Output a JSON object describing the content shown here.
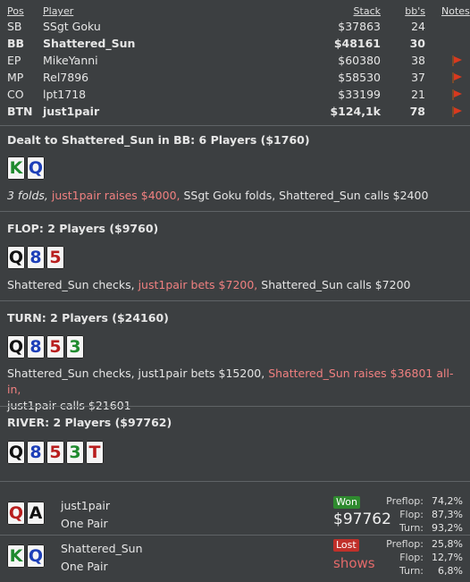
{
  "headers": {
    "pos": "Pos",
    "player": "Player",
    "stack": "Stack",
    "bbs": "bb's",
    "notes": "Notes"
  },
  "players": [
    {
      "pos": "SB",
      "name": "SSgt Goku",
      "stack": "$37863",
      "bbs": "24",
      "note_icon": ""
    },
    {
      "pos": "BB",
      "name": "Shattered_Sun",
      "stack": "$48161",
      "bbs": "30",
      "note_icon": ""
    },
    {
      "pos": "EP",
      "name": "MikeYanni",
      "stack": "$60380",
      "bbs": "38",
      "note_icon": "red-flag-icon"
    },
    {
      "pos": "MP",
      "name": "Rel7896",
      "stack": "$58530",
      "bbs": "37",
      "note_icon": "red-flag-icon"
    },
    {
      "pos": "CO",
      "name": "lpt1718",
      "stack": "$33199",
      "bbs": "21",
      "note_icon": "red-flag-icon"
    },
    {
      "pos": "BTN",
      "name": "just1pair",
      "stack": "$124,1k",
      "bbs": "78",
      "note_icon": "red-flag-icon"
    }
  ],
  "preflop": {
    "title": "Dealt to Shattered_Sun in BB: 6 Players ($1760)",
    "cards": [
      {
        "rank": "K",
        "suit": "green"
      },
      {
        "rank": "Q",
        "suit": "blue"
      }
    ],
    "folds": "3 folds,",
    "raise": "just1pair raises $4000,",
    "rest": "SSgt Goku folds, Shattered_Sun calls $2400"
  },
  "flop": {
    "title": "FLOP: 2 Players ($9760)",
    "cards": [
      {
        "rank": "Q",
        "suit": "black"
      },
      {
        "rank": "8",
        "suit": "blue"
      },
      {
        "rank": "5",
        "suit": "red"
      }
    ],
    "a1": "Shattered_Sun checks,",
    "a2": "just1pair bets $7200,",
    "a3": "Shattered_Sun calls $7200"
  },
  "turn": {
    "title": "TURN: 2 Players ($24160)",
    "cards": [
      {
        "rank": "Q",
        "suit": "black"
      },
      {
        "rank": "8",
        "suit": "blue"
      },
      {
        "rank": "5",
        "suit": "red"
      },
      {
        "rank": "3",
        "suit": "green"
      }
    ],
    "a1": "Shattered_Sun checks, just1pair bets $15200,",
    "a2": "Shattered_Sun raises $36801 all-in,",
    "a3": "just1pair calls $21601"
  },
  "river": {
    "title": "RIVER: 2 Players ($97762)",
    "cards": [
      {
        "rank": "Q",
        "suit": "black"
      },
      {
        "rank": "8",
        "suit": "blue"
      },
      {
        "rank": "5",
        "suit": "red"
      },
      {
        "rank": "3",
        "suit": "green"
      },
      {
        "rank": "T",
        "suit": "red"
      }
    ]
  },
  "results": [
    {
      "cards": [
        {
          "rank": "Q",
          "suit": "red"
        },
        {
          "rank": "A",
          "suit": "black"
        }
      ],
      "name": "just1pair",
      "hand": "One Pair",
      "badge": "Won",
      "amount": "$97762",
      "equity": [
        {
          "label": "Preflop:",
          "value": "74,2%"
        },
        {
          "label": "Flop:",
          "value": "87,3%"
        },
        {
          "label": "Turn:",
          "value": "93,2%"
        }
      ]
    },
    {
      "cards": [
        {
          "rank": "K",
          "suit": "green"
        },
        {
          "rank": "Q",
          "suit": "blue"
        }
      ],
      "name": "Shattered_Sun",
      "hand": "One Pair",
      "badge": "Lost",
      "shows": "shows",
      "equity": [
        {
          "label": "Preflop:",
          "value": "25,8%"
        },
        {
          "label": "Flop:",
          "value": "12,7%"
        },
        {
          "label": "Turn:",
          "value": "6,8%"
        }
      ]
    }
  ],
  "colors": {
    "background": "#3c3f41",
    "highlight": "#f08080",
    "won": "#2f8a2f",
    "lost": "#c0302a"
  }
}
